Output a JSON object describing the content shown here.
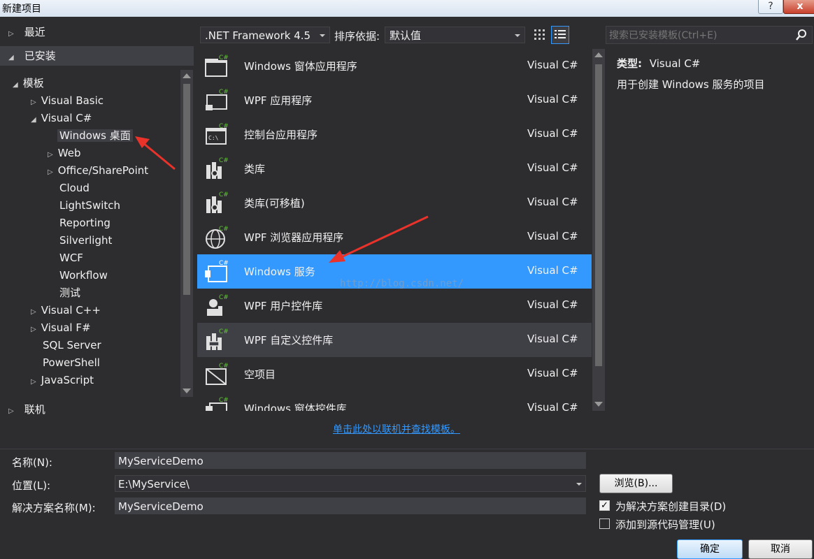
{
  "window": {
    "title": "新建项目",
    "help": "?",
    "close": "x"
  },
  "left": {
    "recent": "最近",
    "installed": "已安装",
    "online": "联机",
    "tree": {
      "templates": "模板",
      "visual_basic": "Visual Basic",
      "visual_csharp": "Visual C#",
      "windows_desktop": "Windows 桌面",
      "web": "Web",
      "office": "Office/SharePoint",
      "cloud": "Cloud",
      "lightswitch": "LightSwitch",
      "reporting": "Reporting",
      "silverlight": "Silverlight",
      "wcf": "WCF",
      "workflow": "Workflow",
      "test": "测试",
      "visual_cpp": "Visual C++",
      "visual_fsharp": "Visual F#",
      "sql_server": "SQL Server",
      "powershell": "PowerShell",
      "javascript": "JavaScript"
    }
  },
  "toolbar": {
    "framework": ".NET Framework 4.5",
    "sort_label": "排序依据:",
    "sort_value": "默认值",
    "search_placeholder": "搜索已安装模板(Ctrl+E)"
  },
  "templates": [
    {
      "name": "Windows 窗体应用程序",
      "lang": "Visual C#"
    },
    {
      "name": "WPF 应用程序",
      "lang": "Visual C#"
    },
    {
      "name": "控制台应用程序",
      "lang": "Visual C#"
    },
    {
      "name": "类库",
      "lang": "Visual C#"
    },
    {
      "name": "类库(可移植)",
      "lang": "Visual C#"
    },
    {
      "name": "WPF 浏览器应用程序",
      "lang": "Visual C#"
    },
    {
      "name": "Windows 服务",
      "lang": "Visual C#"
    },
    {
      "name": "WPF 用户控件库",
      "lang": "Visual C#"
    },
    {
      "name": "WPF 自定义控件库",
      "lang": "Visual C#"
    },
    {
      "name": "空项目",
      "lang": "Visual C#"
    },
    {
      "name": "Windows 窗体控件库",
      "lang": "Visual C#"
    }
  ],
  "details": {
    "type_label": "类型:",
    "type_value": "Visual C#",
    "description": "用于创建 Windows 服务的项目"
  },
  "online_link": "单击此处以联机并查找模板。",
  "watermark": "http://blog.csdn.net/",
  "form": {
    "name_label": "名称(N):",
    "name_value": "MyServiceDemo",
    "location_label": "位置(L):",
    "location_value": "E:\\MyService\\",
    "solution_label": "解决方案名称(M):",
    "solution_value": "MyServiceDemo",
    "browse": "浏览(B)...",
    "create_dir": "为解决方案创建目录(D)",
    "add_source_control": "添加到源代码管理(U)",
    "ok": "确定",
    "cancel": "取消"
  },
  "colors": {
    "accent": "#3399ff",
    "background": "#2d2d30",
    "annotation": "#e8322a",
    "csharp_badge": "#68c142"
  }
}
